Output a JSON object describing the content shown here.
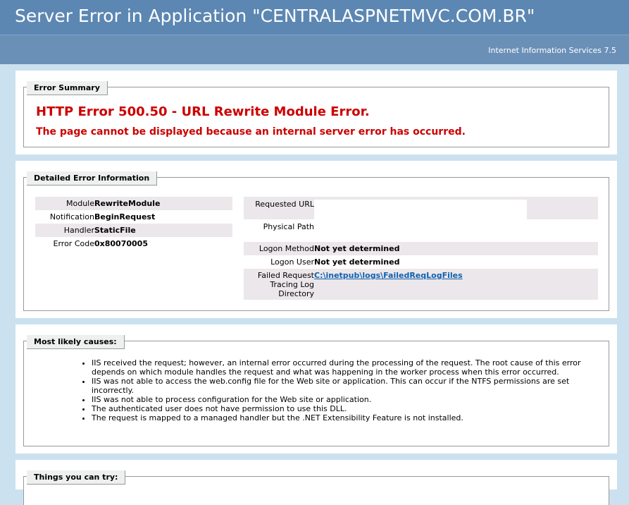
{
  "header": {
    "title": "Server Error in Application \"CENTRALASPNETMVC.COM.BR\"",
    "server": "Internet Information Services 7.5"
  },
  "summary": {
    "legend": "Error Summary",
    "heading": "HTTP Error 500.50 - URL Rewrite Module Error.",
    "message": "The page cannot be displayed because an internal server error has occurred."
  },
  "details": {
    "legend": "Detailed Error Information",
    "left": [
      {
        "label": "Module",
        "value": "RewriteModule"
      },
      {
        "label": "Notification",
        "value": "BeginRequest"
      },
      {
        "label": "Handler",
        "value": "StaticFile"
      },
      {
        "label": "Error Code",
        "value": "0x80070005"
      }
    ],
    "requested_url_label": "Requested URL",
    "requested_url_value": "",
    "physical_path_label": "Physical Path",
    "physical_path_value": "",
    "logon_method_label": "Logon Method",
    "logon_method_value": "Not yet determined",
    "logon_user_label": "Logon User",
    "logon_user_value": "Not yet determined",
    "failed_request_label_1": "Failed Request",
    "failed_request_label_2": "Tracing Log",
    "failed_request_label_3": "Directory",
    "failed_request_value": "C:\\inetpub\\logs\\FailedReqLogFiles"
  },
  "causes": {
    "legend": "Most likely causes:",
    "items": [
      "IIS received the request; however, an internal error occurred during the processing of the request. The root cause of this error depends on which module handles the request and what was happening in the worker process when this error occurred.",
      "IIS was not able to access the web.config file for the Web site or application. This can occur if the NTFS permissions are set incorrectly.",
      "IIS was not able to process configuration for the Web site or application.",
      "The authenticated user does not have permission to use this DLL.",
      "The request is mapped to a managed handler but the .NET Extensibility Feature is not installed."
    ]
  },
  "try": {
    "legend": "Things you can try:"
  },
  "colors": {
    "header_bg": "#5c87b2",
    "page_bg": "#cbe1ef",
    "error_red": "#cc0000",
    "row_shade": "#ebe7ea",
    "link": "#1060b0"
  }
}
